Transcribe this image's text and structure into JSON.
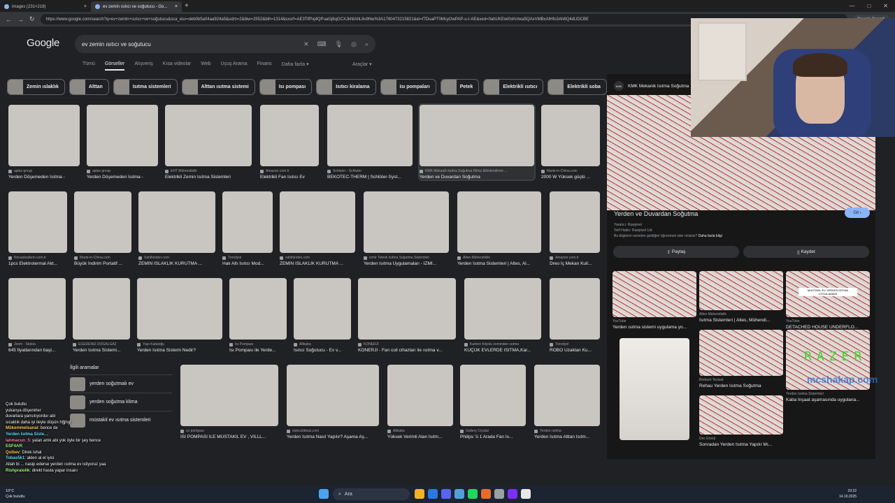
{
  "browser": {
    "tabs": [
      {
        "label": "images (231×218)",
        "active": false
      },
      {
        "label": "ev zemin ısıtıcı ve soğutucu - Go...",
        "active": true
      }
    ],
    "new_tab": "+",
    "url": "https://www.google.com/search?q=ev+zemin+ısıtıcı+ve+soğutucu&sca_esv=deb0b5a04aa924a5&udm=2&biw=2552&bih=1314&sxsrf=AE3TifPxj4QPuaGj6qGCXJkNlAhL8v9Nw%3A1760473215821&ei=f7DuaPT0McyOwPAP-u-I-AE&ved=0ahUKEwi0sKnIwa5QAxVMBxAIHfo3Ah8Q4dUDCBE",
    "profile": "Google Search"
  },
  "search": {
    "logo": "Google",
    "query": "ev zemin ısıtıcı ve soğutucu",
    "filters": [
      "Tümü",
      "Görseller",
      "Alışveriş",
      "Kısa videolar",
      "Web",
      "Uçuş Arama",
      "Finans",
      "Daha fazla ▾"
    ],
    "active_filter_index": 1,
    "tools": "Araçlar ▾"
  },
  "chips": [
    "Zemin ıslaklık",
    "Alttan",
    "Isıtma sistemleri",
    "Alttan ısıtma sistemi",
    "Isı pompası",
    "Isıtıcı kiralama",
    "Isı pompaları",
    "Petek",
    "Elektrikli ısıtıcı",
    "Elektrikli soba",
    "Kalorifer",
    "Kaynaklı ısı"
  ],
  "results": [
    {
      "src": "aplas group",
      "title": "Yerden Döşemeden Isıtma -"
    },
    {
      "src": "aplas group",
      "title": "Yerden Döşemeden Isıtma -"
    },
    {
      "src": "EHT Mühendislik",
      "title": "Elektrikli Zemin Isıtma Sistemleri"
    },
    {
      "src": "Amazon.com.tr",
      "title": "Elektrikli Fan Isıtıcı Ev"
    },
    {
      "src": "Schluter - Schluter",
      "title": "BEKOTEC-THERM | Schlüter-Syst..."
    },
    {
      "src": "KMK Mekanik Isıtma Soğutma Klima İklimlendirme ...",
      "title": "Yerden ve Duvardan Soğutma"
    },
    {
      "src": "Made-in-China.com",
      "title": "2000 W Yüksek güçlü ..."
    },
    {
      "src": "Novaakademi.com.tr",
      "title": "1pcs Elektrotermal Akt..."
    },
    {
      "src": "Made-in-China.com",
      "title": "Büyük İndirim Portatif ..."
    },
    {
      "src": "Sahibinden.com",
      "title": "ZEMİN ISLAKLIK KURUTMA ..."
    },
    {
      "src": "Trendyol",
      "title": "Halı Altı Isıtıcı Mod..."
    },
    {
      "src": "sahibinden.com",
      "title": "ZEMİN ISLAKLIK KURUTMA ..."
    },
    {
      "src": "İzmir Teknik Isıtma Soğutma Sistemleri",
      "title": "Yerden Isıtma Uygulamaları - İZMİ..."
    },
    {
      "src": "Altes Mühendislik",
      "title": "Yerden Isıtma Sistemleri | Altes, Al..."
    },
    {
      "src": "Amazon.com.tr",
      "title": "Dreo İç Mekan Kull..."
    },
    {
      "src": "Joom · Stokta",
      "title": "645 fiyatlarından başl..."
    },
    {
      "src": "EGEDENİZ DOĞALGAZ",
      "title": "Yerden Isıtma Sistemi..."
    },
    {
      "src": "Yapı Kataloğu",
      "title": "Yerden Isıtma Sistemi Nedir?"
    },
    {
      "src": "Isı Pompası",
      "title": "Isı Pompası ile Yerde..."
    },
    {
      "src": "Alibaba",
      "title": "Isıtıcı Soğutucu - Ev v..."
    },
    {
      "src": "KONERJİ",
      "title": "KONERJİ - Fan coil cihazları ile ısıtma v..."
    },
    {
      "src": "Karbon folyolu zeminden ısıtma",
      "title": "KÜÇÜK EVLERDE ISITMA,Kar..."
    },
    {
      "src": "Trendyol",
      "title": "ROBO Uzaktan Ku..."
    },
    {
      "src": "ısı pompası",
      "title": "ISI POMPASI İLE MÜSTAKİL EV , VİLLL..."
    },
    {
      "src": "www.isitmax.com",
      "title": "Yerden Isıtma Nasıl Yapılır? Aşama Aş..."
    },
    {
      "src": "Alibaba",
      "title": "Yüksek Verimli Alan Isıtm..."
    },
    {
      "src": "Gallery Crystal",
      "title": "Philips 'ü 1 Arada Fan Is..."
    },
    {
      "src": "Yerden ısıtma",
      "title": "Yerden Isıtma Alttan Isıtm..."
    }
  ],
  "related": {
    "heading": "İlgili aramalar",
    "items": [
      "yerden soğutmalı ev",
      "yerden soğutma klima",
      "müstakil ev ısıtma sistemleri"
    ]
  },
  "panel": {
    "brand": "KMK Mekanik Isıtma Soğutma",
    "brand_logo": "KMK",
    "title": "Yerden ve Duvardan Soğutma",
    "visit": "Git ›",
    "creator": "Yaratıcı: Rawpixel",
    "rights": "Telif Hakkı: Rawpixel Ltd",
    "info": "Bu bilgilerin nereden geldiğini öğrenmek ister misiniz?",
    "info_link": "Daha fazla bilgi",
    "share": "Paylaş",
    "save": "Kaydet",
    "similar": [
      {
        "src": "YouTube",
        "title": "Yerden ısıtma sistemi uygulama yo..."
      },
      {
        "src": "Altes Mühendislik",
        "title": "Isıtma Sistemleri | Altes, Mühendi..."
      },
      {
        "src": "YouTube",
        "title": "DETACHED HOUSE UNDERFLO..."
      },
      {
        "src": "Bodrum Tesisat",
        "title": "Rehau Yerden Isıtma Soğutma"
      },
      {
        "src": "Yerden Isıtma Sistemleri",
        "title": "Kaba İnşaat aşamasında uygulana..."
      },
      {
        "src": "Dec Enerji",
        "title": "Sonradan Yerden Isıtma Yapılır Mı..."
      }
    ],
    "badge": "MÜSTAKİL EV YERDEN ISITMA UYGULAMASI"
  },
  "overlay": {
    "razer": "RAZER",
    "kick": "mcshakap.com",
    "chat": [
      {
        "user": "",
        "msg": "Çok bulutlu"
      },
      {
        "user": "",
        "msg": "yukarıya döşenirler"
      },
      {
        "user": "",
        "msg": "duvarlara yansıtıyordur abi"
      },
      {
        "user": "",
        "msg": "sıcaklık daha iyi ileyle düşün hğjhgf"
      },
      {
        "user": "Mükemmelsanat",
        "msg": "bence de"
      },
      {
        "user": "Yerden Isıtma Siste...",
        "msg": ""
      },
      {
        "user": "lahmacun_5",
        "msg": "yalan amk abi yok öyle bir şey bence"
      },
      {
        "user": "ESF4AR",
        "msg": ""
      },
      {
        "user": "Qsibev",
        "msg": "Direk ishal"
      },
      {
        "user": "Tobas5k1",
        "msg": "aklen al el iyisi"
      },
      {
        "user": "",
        "msg": "Allah bi ... nasip ederse yerden ısıtma ev istiyoruz yaa"
      },
      {
        "user": "Rishpraiolik",
        "msg": "direkt hasta yapar insanı"
      }
    ]
  },
  "taskbar": {
    "weather_temp": "10°C",
    "weather_desc": "Çok bulutlu",
    "search": "Ara",
    "time": "23:22",
    "date": "14.10.2025",
    "icon_colors": [
      "#f0b429",
      "#2b78e4",
      "#5865f2",
      "#53a0d8",
      "#1ed760",
      "#e86b2c",
      "#9aa0a6",
      "#7b2ff7",
      "#e8e8e8"
    ]
  }
}
